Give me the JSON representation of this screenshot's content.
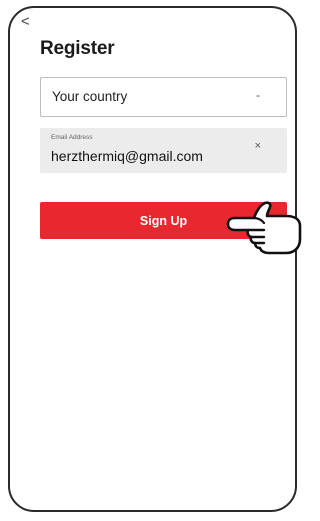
{
  "header": {
    "back_glyph": "<",
    "title": "Register"
  },
  "form": {
    "country": {
      "label": "Your country",
      "caret_glyph": "-"
    },
    "email": {
      "label": "Email Address",
      "value": "herzthermiq@gmail.com",
      "clear_glyph": "×"
    },
    "signup_label": "Sign Up"
  },
  "icons": {
    "back": "back-chevron-icon",
    "caret": "dropdown-caret-icon",
    "clear": "clear-icon",
    "pointer": "hand-pointer-icon"
  },
  "colors": {
    "accent": "#e8282e",
    "field_background": "#ececec"
  }
}
